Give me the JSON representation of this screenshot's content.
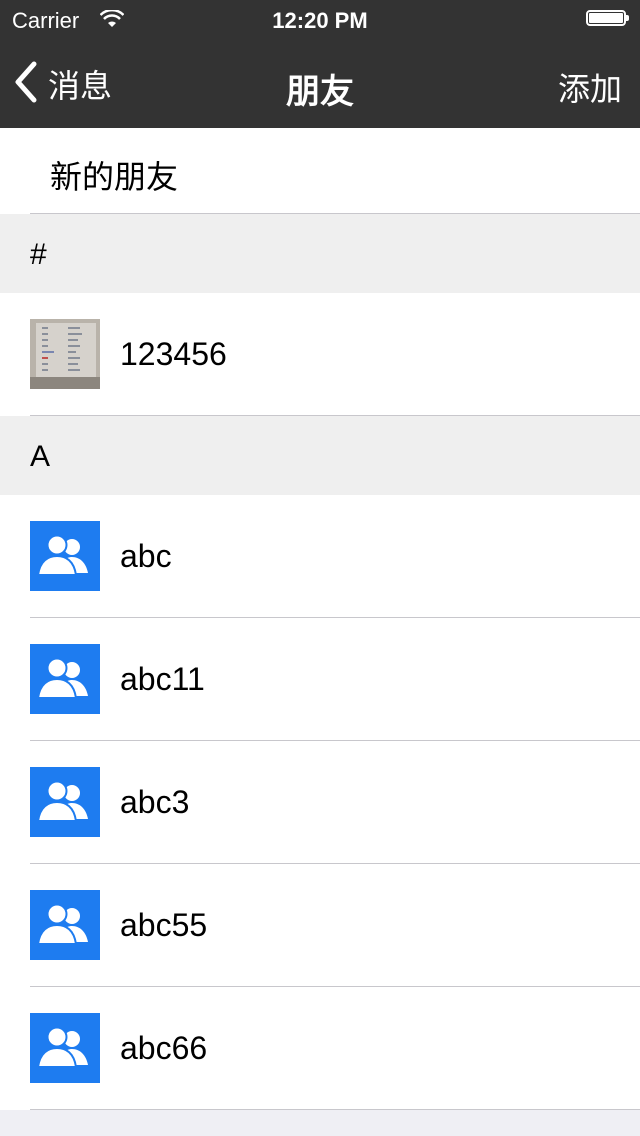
{
  "status_bar": {
    "carrier": "Carrier",
    "time": "12:20 PM"
  },
  "nav": {
    "back_label": "消息",
    "title": "朋友",
    "right_action": "添加"
  },
  "new_friends_label": "新的朋友",
  "sections": [
    {
      "header": "#",
      "contacts": [
        {
          "name": "123456",
          "avatar": "photo"
        }
      ]
    },
    {
      "header": "A",
      "contacts": [
        {
          "name": "abc",
          "avatar": "group-icon"
        },
        {
          "name": "abc11",
          "avatar": "group-icon"
        },
        {
          "name": "abc3",
          "avatar": "group-icon"
        },
        {
          "name": "abc55",
          "avatar": "group-icon"
        },
        {
          "name": "abc66",
          "avatar": "group-icon"
        }
      ]
    }
  ],
  "colors": {
    "bar": "#333333",
    "avatar_blue": "#1e7cf0",
    "section_bg": "#efefef"
  }
}
